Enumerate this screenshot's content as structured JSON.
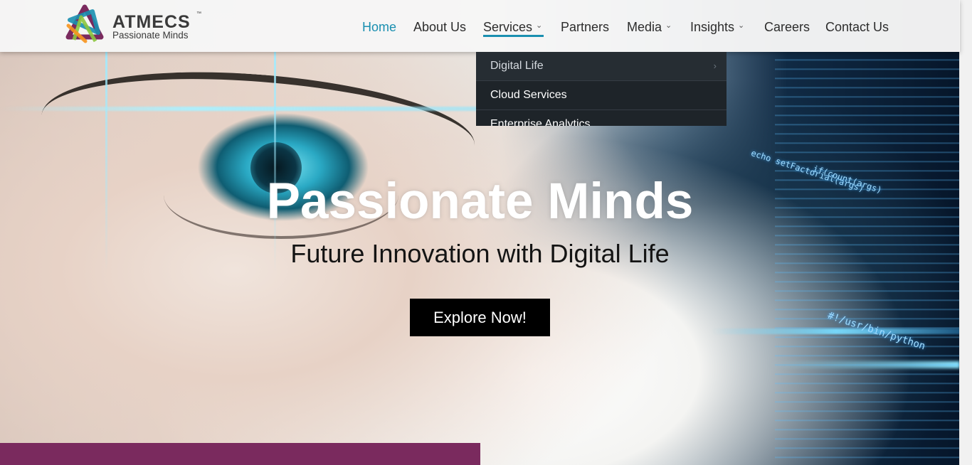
{
  "brand": {
    "name": "ATMECS",
    "trademark": "™",
    "tagline": "Passionate Minds"
  },
  "nav": {
    "items": [
      {
        "label": "Home",
        "active": true,
        "has_submenu": false
      },
      {
        "label": "About Us",
        "active": false,
        "has_submenu": false
      },
      {
        "label": "Services",
        "active": false,
        "has_submenu": true
      },
      {
        "label": "Partners",
        "active": false,
        "has_submenu": false
      },
      {
        "label": "Media",
        "active": false,
        "has_submenu": true
      },
      {
        "label": "Insights",
        "active": false,
        "has_submenu": true
      },
      {
        "label": "Careers",
        "active": false,
        "has_submenu": false
      },
      {
        "label": "Contact Us",
        "active": false,
        "has_submenu": false
      }
    ],
    "submenu_icon": "chevron-down-icon",
    "active_color": "#1a8fb0"
  },
  "services_menu": {
    "items": [
      {
        "label": "Digital Life",
        "has_submenu": true
      },
      {
        "label": "Cloud Services",
        "has_submenu": false
      },
      {
        "label": "Enterprise Analytics",
        "has_submenu": false
      }
    ],
    "submenu_icon": "chevron-right-icon"
  },
  "hero": {
    "title": "Passionate Minds",
    "subtitle": "Future Innovation with Digital Life",
    "cta_label": "Explore Now!",
    "code_snippets": [
      "echo setFactorial(args)",
      "#!/usr/bin/python",
      "if(count(args)"
    ]
  },
  "colors": {
    "accent": "#1a8fb0",
    "band": "#7a2a5e",
    "dropdown_bg": "#1e2429"
  }
}
